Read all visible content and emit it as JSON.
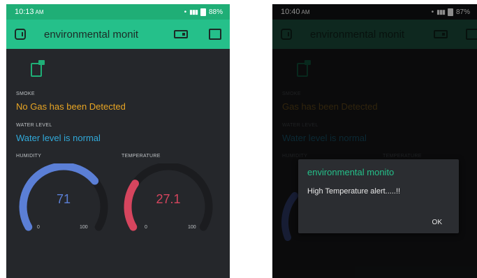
{
  "colors": {
    "accent": "#25c08a",
    "smoke_text": "#e8a524",
    "water_text": "#31a9d9",
    "humidity_gauge": "#5b7fd6",
    "temperature_gauge": "#d6455e",
    "gauge_track": "#1b1c1f"
  },
  "left_screen": {
    "status": {
      "time": "10:13",
      "ampm": "AM",
      "battery": "88%"
    },
    "app_title": "environmental monit",
    "smoke": {
      "label": "SMOKE",
      "value": "No Gas has been Detected"
    },
    "water": {
      "label": "WATER LEVEL",
      "value": "Water level is normal"
    },
    "humidity": {
      "label": "HUMIDITY",
      "value": 71,
      "display": "71",
      "min": "0",
      "max": "100"
    },
    "temperature": {
      "label": "TEMPERATURE",
      "value": 27.1,
      "display": "27.1",
      "min": "0",
      "max": "100"
    }
  },
  "right_screen": {
    "status": {
      "time": "10:40",
      "ampm": "AM",
      "battery": "87%"
    },
    "app_title": "environmental monit",
    "smoke": {
      "label": "SMOKE",
      "value": "Gas has been Detected"
    },
    "water": {
      "label": "WATER LEVEL",
      "value": "Water level is normal"
    },
    "humidity": {
      "label": "HUMIDITY"
    },
    "temperature": {
      "label": "TEMPERATURE"
    },
    "dialog": {
      "title": "environmental monito",
      "message": "High Temperature alert.....!!",
      "ok_label": "OK"
    }
  }
}
